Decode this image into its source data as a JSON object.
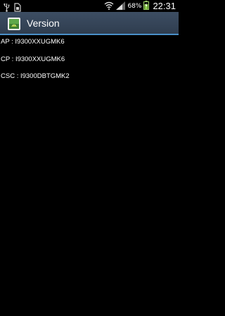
{
  "status_bar": {
    "battery_percent": "68%",
    "time": "22:31",
    "icons": [
      "usb-icon",
      "sd-card-icon",
      "wifi-icon",
      "signal-icon",
      "battery-charging-icon"
    ]
  },
  "action_bar": {
    "title": "Version",
    "icon": "android-app-icon"
  },
  "content": {
    "lines": [
      "AP : I9300XXUGMK6",
      "CP : I9300XXUGMK6",
      "CSC : I9300DBTGMK2"
    ]
  }
}
